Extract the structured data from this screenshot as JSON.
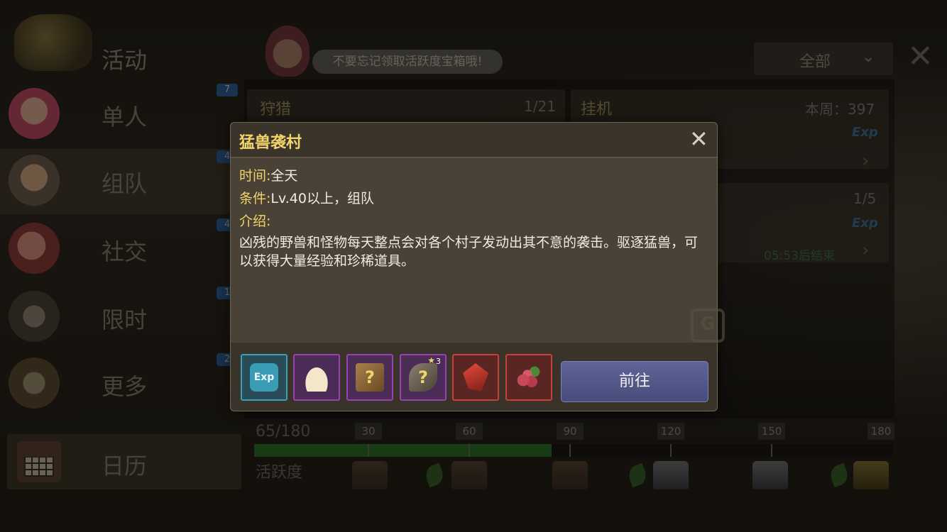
{
  "sidebar": {
    "title": "活动",
    "items": [
      {
        "label": "单人",
        "badge": "7"
      },
      {
        "label": "组队",
        "badge": "4"
      },
      {
        "label": "社交",
        "badge": "4"
      },
      {
        "label": "限时",
        "badge": "1"
      },
      {
        "label": "更多",
        "badge": "2"
      }
    ],
    "calendar_label": "日历"
  },
  "header": {
    "tip": "不要忘记领取活跃度宝箱哦!",
    "filter_value": "全部"
  },
  "cards": {
    "hunt_title": "狩猎",
    "hunt_count": "1/21",
    "idle_title": "挂机",
    "idle_count": "本周：397",
    "exp_tag": "Exp",
    "second_count": "1/5",
    "timer": "05:53后结束"
  },
  "activity": {
    "progress_text": "65/180",
    "label": "活跃度",
    "progress_value": 65,
    "max": 180,
    "milestones": [
      "30",
      "60",
      "90",
      "120",
      "150",
      "180"
    ]
  },
  "dialog": {
    "title": "猛兽袭村",
    "time_key": "时间:",
    "time_val": "全天",
    "cond_key": "条件:",
    "cond_val": "Lv.40以上，组队",
    "intro_key": "介绍:",
    "description": "凶残的野兽和怪物每天整点会对各个村子发动出其不意的袭击。驱逐猛兽，可以获得大量经验和珍稀道具。",
    "go_label": "前往",
    "reward_star_count": "3",
    "reward_exp_label": "Exp"
  },
  "colors": {
    "accent_gold": "#f2d56a",
    "button_blue": "#5e6496",
    "progress_green": "#2c6a26",
    "purple_frame": "#9a40b8",
    "red_frame": "#c8403a",
    "blue_frame": "#3aa0b8"
  }
}
